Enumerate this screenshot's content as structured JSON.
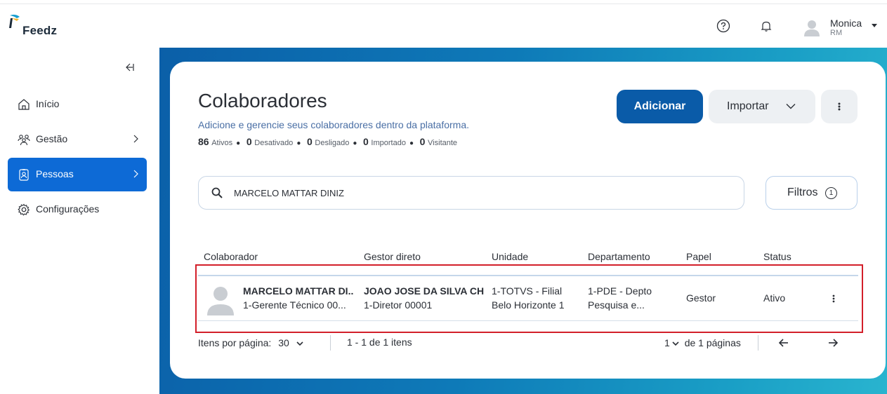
{
  "app": {
    "brand": "Feedz",
    "accent": "#0d6ad6",
    "primary_button": "#0a5ba8",
    "selection_outline": "#d31f2a"
  },
  "topbar": {
    "help_icon": "question-circle-icon",
    "notifications_icon": "bell-icon",
    "user": {
      "name": "Monica",
      "initials": "RM"
    }
  },
  "sidebar": {
    "collapse_icon": "collapse-left-icon",
    "items": [
      {
        "label": "Início",
        "icon": "home-icon",
        "has_submenu": false,
        "active": false
      },
      {
        "label": "Gestão",
        "icon": "people-group-icon",
        "has_submenu": true,
        "active": false
      },
      {
        "label": "Pessoas",
        "icon": "id-badge-icon",
        "has_submenu": true,
        "active": true
      },
      {
        "label": "Configurações",
        "icon": "gear-icon",
        "has_submenu": false,
        "active": false
      }
    ]
  },
  "page": {
    "title": "Colaboradores",
    "subtitle": "Adicione e gerencie seus colaboradores dentro da plataforma.",
    "stats": [
      {
        "count": "86",
        "label": "Ativos"
      },
      {
        "count": "0",
        "label": "Desativado"
      },
      {
        "count": "0",
        "label": "Desligado"
      },
      {
        "count": "0",
        "label": "Importado"
      },
      {
        "count": "0",
        "label": "Visitante"
      }
    ],
    "add_button": "Adicionar",
    "import_button": "Importar",
    "search": {
      "value": "MARCELO MATTAR DINIZ"
    },
    "filters_button": "Filtros",
    "filters_count": "1"
  },
  "table": {
    "columns": [
      "Colaborador",
      "Gestor direto",
      "Unidade",
      "Departamento",
      "Papel",
      "Status"
    ],
    "rows": [
      {
        "name": "MARCELO MATTAR DI...",
        "position": "1-Gerente Técnico 00...",
        "manager_name": "JOAO JOSE DA SILVA CH...",
        "manager_position": "1-Diretor 00001",
        "unit_line1": "1-TOTVS - Filial",
        "unit_line2": "Belo Horizonte 1",
        "dept_line1": "1-PDE - Depto",
        "dept_line2": "Pesquisa e...",
        "role": "Gestor",
        "status": "Ativo"
      }
    ]
  },
  "pagination": {
    "per_page_label": "Itens por página:",
    "per_page_value": "30",
    "range_text": "1 - 1 de 1 itens",
    "current_page": "1",
    "pages_text": "de 1 páginas"
  }
}
